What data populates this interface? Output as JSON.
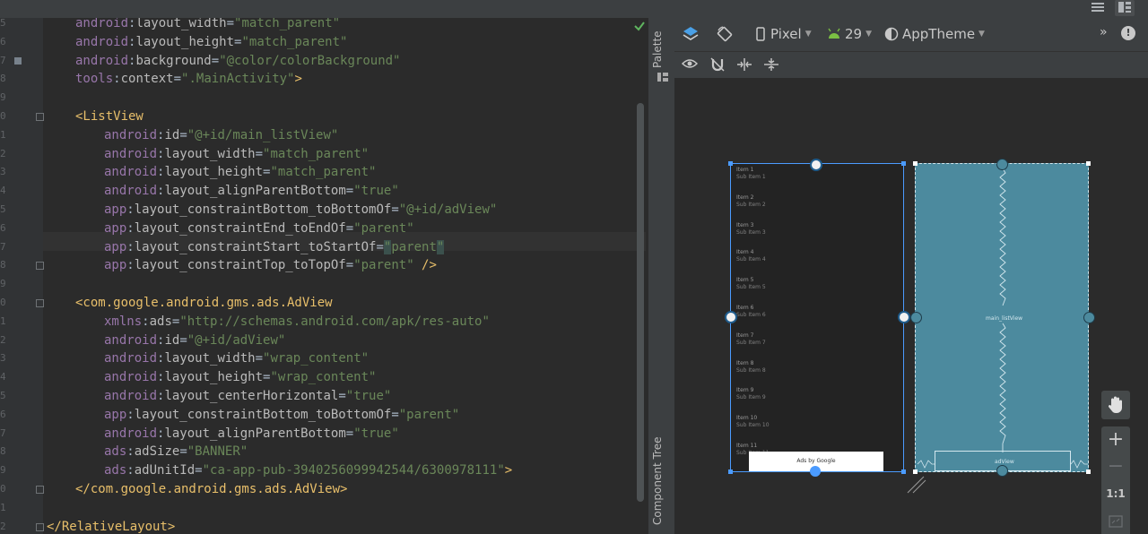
{
  "topbar": {
    "list_view_icon": "list-view-icon",
    "split_view_icon": "split-view-icon"
  },
  "editor": {
    "line_numbers": [
      "5",
      "6",
      "7",
      "8",
      "9",
      "0",
      "1",
      "2",
      "3",
      "4",
      "5",
      "6",
      "7",
      "8",
      "9",
      "0",
      "1",
      "2",
      "3",
      "4",
      "5",
      "6",
      "7",
      "8",
      "9",
      "0",
      "1",
      "2"
    ],
    "code": {
      "l0": {
        "ns": "android",
        "attr": "layout_width",
        "val": "\"match_parent\""
      },
      "l1": {
        "ns": "android",
        "attr": "layout_height",
        "val": "\"match_parent\""
      },
      "l2": {
        "ns": "android",
        "attr": "background",
        "val": "\"@color/colorBackground\""
      },
      "l3": {
        "ns": "tools",
        "attr": "context",
        "val": "\".MainActivity\"",
        "close": ">"
      },
      "l5": {
        "tag": "<ListView"
      },
      "l6": {
        "ns": "android",
        "attr": "id",
        "val": "\"@+id/main_listView\""
      },
      "l7": {
        "ns": "android",
        "attr": "layout_width",
        "val": "\"match_parent\""
      },
      "l8": {
        "ns": "android",
        "attr": "layout_height",
        "val": "\"match_parent\""
      },
      "l9": {
        "ns": "android",
        "attr": "layout_alignParentBottom",
        "val": "\"true\""
      },
      "l10": {
        "ns": "app",
        "attr": "layout_constraintBottom_toBottomOf",
        "val": "\"@+id/adView\""
      },
      "l11": {
        "ns": "app",
        "attr": "layout_constraintEnd_toEndOf",
        "val": "\"parent\""
      },
      "l12": {
        "ns": "app",
        "attr": "layout_constraintStart_toStartOf",
        "val_q1": "\"",
        "val_mid": "parent",
        "val_q2": "\""
      },
      "l13": {
        "ns": "app",
        "attr": "layout_constraintTop_toTopOf",
        "val": "\"parent\"",
        "close": " />"
      },
      "l15": {
        "tag": "<com.google.android.gms.ads.AdView"
      },
      "l16": {
        "ns": "xmlns",
        "attr": "ads",
        "val": "\"http://schemas.android.com/apk/res-auto\""
      },
      "l17": {
        "ns": "android",
        "attr": "id",
        "val": "\"@+id/adView\""
      },
      "l18": {
        "ns": "android",
        "attr": "layout_width",
        "val": "\"wrap_content\""
      },
      "l19": {
        "ns": "android",
        "attr": "layout_height",
        "val": "\"wrap_content\""
      },
      "l20": {
        "ns": "android",
        "attr": "layout_centerHorizontal",
        "val": "\"true\""
      },
      "l21": {
        "ns": "app",
        "attr": "layout_constraintBottom_toBottomOf",
        "val": "\"parent\""
      },
      "l22": {
        "ns": "android",
        "attr": "layout_alignParentBottom",
        "val": "\"true\""
      },
      "l23": {
        "ns": "ads",
        "attr": "adSize",
        "val": "\"BANNER\""
      },
      "l24": {
        "ns": "ads",
        "attr": "adUnitId",
        "val": "\"ca-app-pub-3940256099942544/6300978111\"",
        "close": ">"
      },
      "l25": {
        "tag": "</com.google.android.gms.ads.AdView>"
      },
      "l27": {
        "tag": "</RelativeLayout>"
      }
    },
    "colon": ":",
    "eq": "="
  },
  "side_tabs": {
    "palette": "Palette",
    "component_tree": "Component Tree"
  },
  "design_toolbar": {
    "device": "Pixel",
    "api": "29",
    "theme": "AppTheme",
    "overflow": "»",
    "warning": "!"
  },
  "preview": {
    "items": [
      {
        "title": "Item 1",
        "sub": "Sub Item 1"
      },
      {
        "title": "Item 2",
        "sub": "Sub Item 2"
      },
      {
        "title": "Item 3",
        "sub": "Sub Item 3"
      },
      {
        "title": "Item 4",
        "sub": "Sub Item 4"
      },
      {
        "title": "Item 5",
        "sub": "Sub Item 5"
      },
      {
        "title": "Item 6",
        "sub": "Sub Item 6"
      },
      {
        "title": "Item 7",
        "sub": "Sub Item 7"
      },
      {
        "title": "Item 8",
        "sub": "Sub Item 8"
      },
      {
        "title": "Item 9",
        "sub": "Sub Item 9"
      },
      {
        "title": "Item 10",
        "sub": "Sub Item 10"
      },
      {
        "title": "Item 11",
        "sub": "Sub Item 11"
      }
    ],
    "ad_label": "Ads by Google",
    "blueprint_listview_label": "main_listView",
    "blueprint_ad_label": "adView"
  },
  "zoom": {
    "plus": "+",
    "minus": "−",
    "one_to_one": "1:1"
  }
}
